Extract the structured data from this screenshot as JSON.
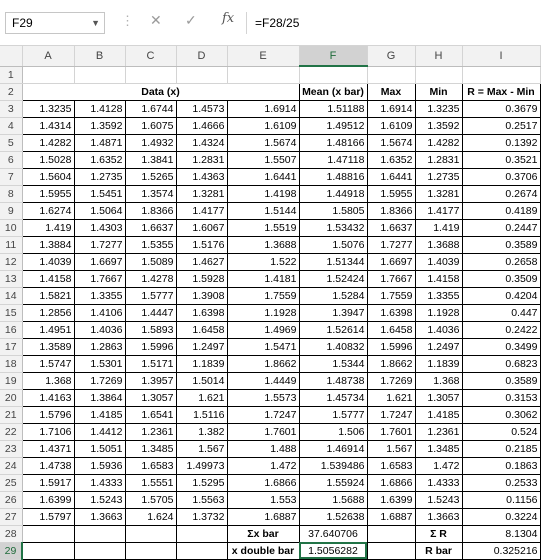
{
  "formula_bar": {
    "cell_ref": "F29",
    "formula": "=F28/25",
    "fx_label": "fx"
  },
  "columns": [
    "A",
    "B",
    "C",
    "D",
    "E",
    "F",
    "G",
    "H",
    "I"
  ],
  "headers": {
    "data_title": "Data (x)",
    "mean": "Mean (x bar)",
    "max": "Max",
    "min": "Min",
    "range": "R = Max - Min"
  },
  "rows": [
    [
      "1.3235",
      "1.4128",
      "1.6744",
      "1.4573",
      "1.6914",
      "1.51188",
      "1.6914",
      "1.3235",
      "0.3679"
    ],
    [
      "1.4314",
      "1.3592",
      "1.6075",
      "1.4666",
      "1.6109",
      "1.49512",
      "1.6109",
      "1.3592",
      "0.2517"
    ],
    [
      "1.4282",
      "1.4871",
      "1.4932",
      "1.4324",
      "1.5674",
      "1.48166",
      "1.5674",
      "1.4282",
      "0.1392"
    ],
    [
      "1.5028",
      "1.6352",
      "1.3841",
      "1.2831",
      "1.5507",
      "1.47118",
      "1.6352",
      "1.2831",
      "0.3521"
    ],
    [
      "1.5604",
      "1.2735",
      "1.5265",
      "1.4363",
      "1.6441",
      "1.48816",
      "1.6441",
      "1.2735",
      "0.3706"
    ],
    [
      "1.5955",
      "1.5451",
      "1.3574",
      "1.3281",
      "1.4198",
      "1.44918",
      "1.5955",
      "1.3281",
      "0.2674"
    ],
    [
      "1.6274",
      "1.5064",
      "1.8366",
      "1.4177",
      "1.5144",
      "1.5805",
      "1.8366",
      "1.4177",
      "0.4189"
    ],
    [
      "1.419",
      "1.4303",
      "1.6637",
      "1.6067",
      "1.5519",
      "1.53432",
      "1.6637",
      "1.419",
      "0.2447"
    ],
    [
      "1.3884",
      "1.7277",
      "1.5355",
      "1.5176",
      "1.3688",
      "1.5076",
      "1.7277",
      "1.3688",
      "0.3589"
    ],
    [
      "1.4039",
      "1.6697",
      "1.5089",
      "1.4627",
      "1.522",
      "1.51344",
      "1.6697",
      "1.4039",
      "0.2658"
    ],
    [
      "1.4158",
      "1.7667",
      "1.4278",
      "1.5928",
      "1.4181",
      "1.52424",
      "1.7667",
      "1.4158",
      "0.3509"
    ],
    [
      "1.5821",
      "1.3355",
      "1.5777",
      "1.3908",
      "1.7559",
      "1.5284",
      "1.7559",
      "1.3355",
      "0.4204"
    ],
    [
      "1.2856",
      "1.4106",
      "1.4447",
      "1.6398",
      "1.1928",
      "1.3947",
      "1.6398",
      "1.1928",
      "0.447"
    ],
    [
      "1.4951",
      "1.4036",
      "1.5893",
      "1.6458",
      "1.4969",
      "1.52614",
      "1.6458",
      "1.4036",
      "0.2422"
    ],
    [
      "1.3589",
      "1.2863",
      "1.5996",
      "1.2497",
      "1.5471",
      "1.40832",
      "1.5996",
      "1.2497",
      "0.3499"
    ],
    [
      "1.5747",
      "1.5301",
      "1.5171",
      "1.1839",
      "1.8662",
      "1.5344",
      "1.8662",
      "1.1839",
      "0.6823"
    ],
    [
      "1.368",
      "1.7269",
      "1.3957",
      "1.5014",
      "1.4449",
      "1.48738",
      "1.7269",
      "1.368",
      "0.3589"
    ],
    [
      "1.4163",
      "1.3864",
      "1.3057",
      "1.621",
      "1.5573",
      "1.45734",
      "1.621",
      "1.3057",
      "0.3153"
    ],
    [
      "1.5796",
      "1.4185",
      "1.6541",
      "1.5116",
      "1.7247",
      "1.5777",
      "1.7247",
      "1.4185",
      "0.3062"
    ],
    [
      "1.7106",
      "1.4412",
      "1.2361",
      "1.382",
      "1.7601",
      "1.506",
      "1.7601",
      "1.2361",
      "0.524"
    ],
    [
      "1.4371",
      "1.5051",
      "1.3485",
      "1.567",
      "1.488",
      "1.46914",
      "1.567",
      "1.3485",
      "0.2185"
    ],
    [
      "1.4738",
      "1.5936",
      "1.6583",
      "1.49973",
      "1.472",
      "1.539486",
      "1.6583",
      "1.472",
      "0.1863"
    ],
    [
      "1.5917",
      "1.4333",
      "1.5551",
      "1.5295",
      "1.6866",
      "1.55924",
      "1.6866",
      "1.4333",
      "0.2533"
    ],
    [
      "1.6399",
      "1.5243",
      "1.5705",
      "1.5563",
      "1.553",
      "1.5688",
      "1.6399",
      "1.5243",
      "0.1156"
    ],
    [
      "1.5797",
      "1.3663",
      "1.624",
      "1.3732",
      "1.6887",
      "1.52638",
      "1.6887",
      "1.3663",
      "0.3224"
    ]
  ],
  "summary": {
    "sum_x_label": "Σx bar",
    "sum_x_value": "37.640706",
    "sum_r_label": "Σ R",
    "sum_r_value": "8.1304",
    "x_double_bar_label": "x double bar",
    "x_double_bar_value": "1.5056282",
    "r_bar_label": "R bar",
    "r_bar_value": "0.325216"
  }
}
